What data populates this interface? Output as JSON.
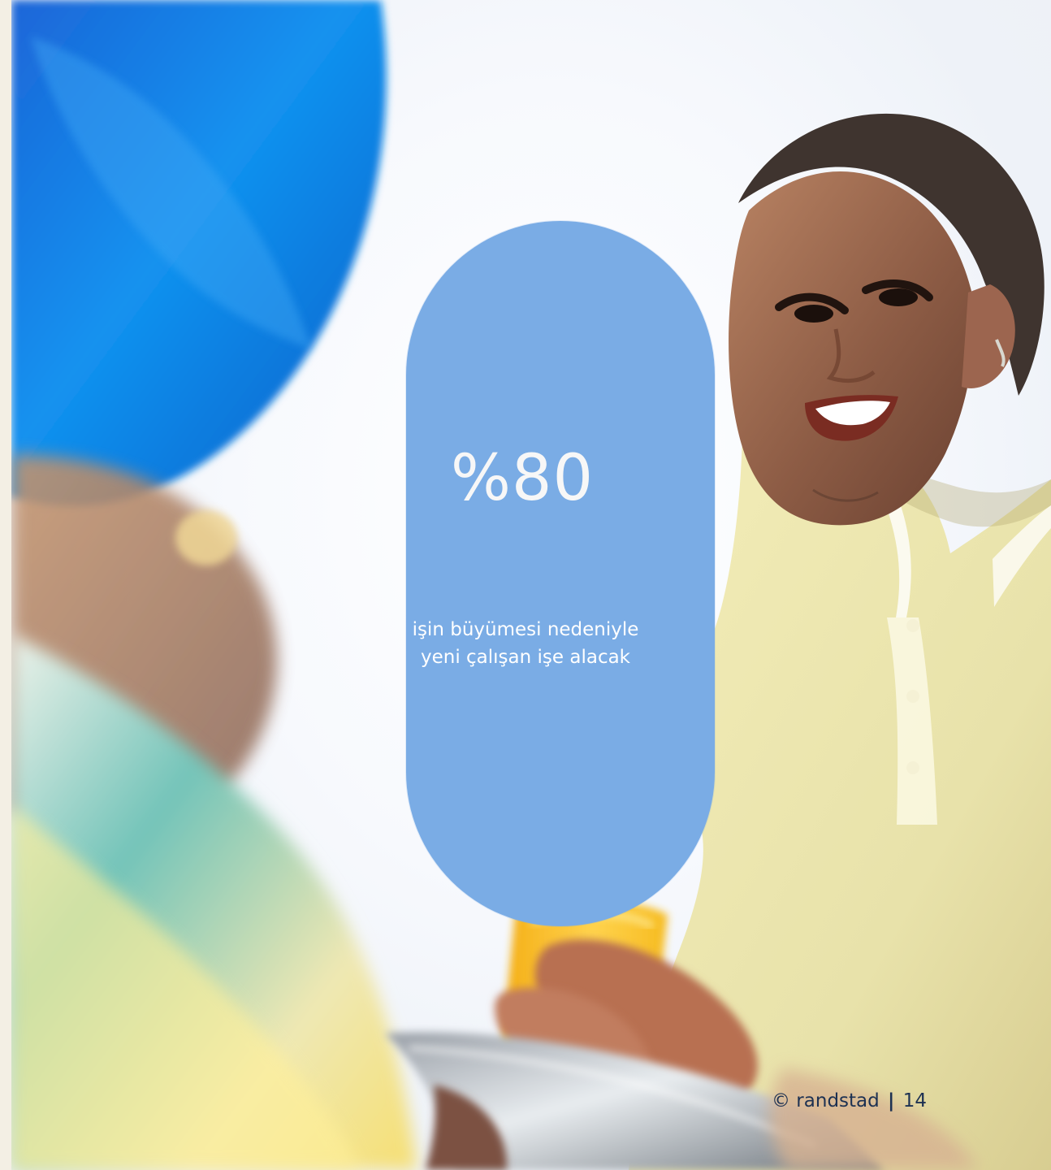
{
  "slide": {
    "stat": "%80",
    "caption_line_1": "işin büyümesi nedeniyle",
    "caption_line_2": "yeni çalışan işe alacak"
  },
  "footer": {
    "copyright": "© randstad",
    "separator": "|",
    "page_number": "14"
  },
  "colors": {
    "pill": "#7aace5",
    "text_on_pill": "#f7f7f7",
    "footer_text": "#1d3152"
  }
}
